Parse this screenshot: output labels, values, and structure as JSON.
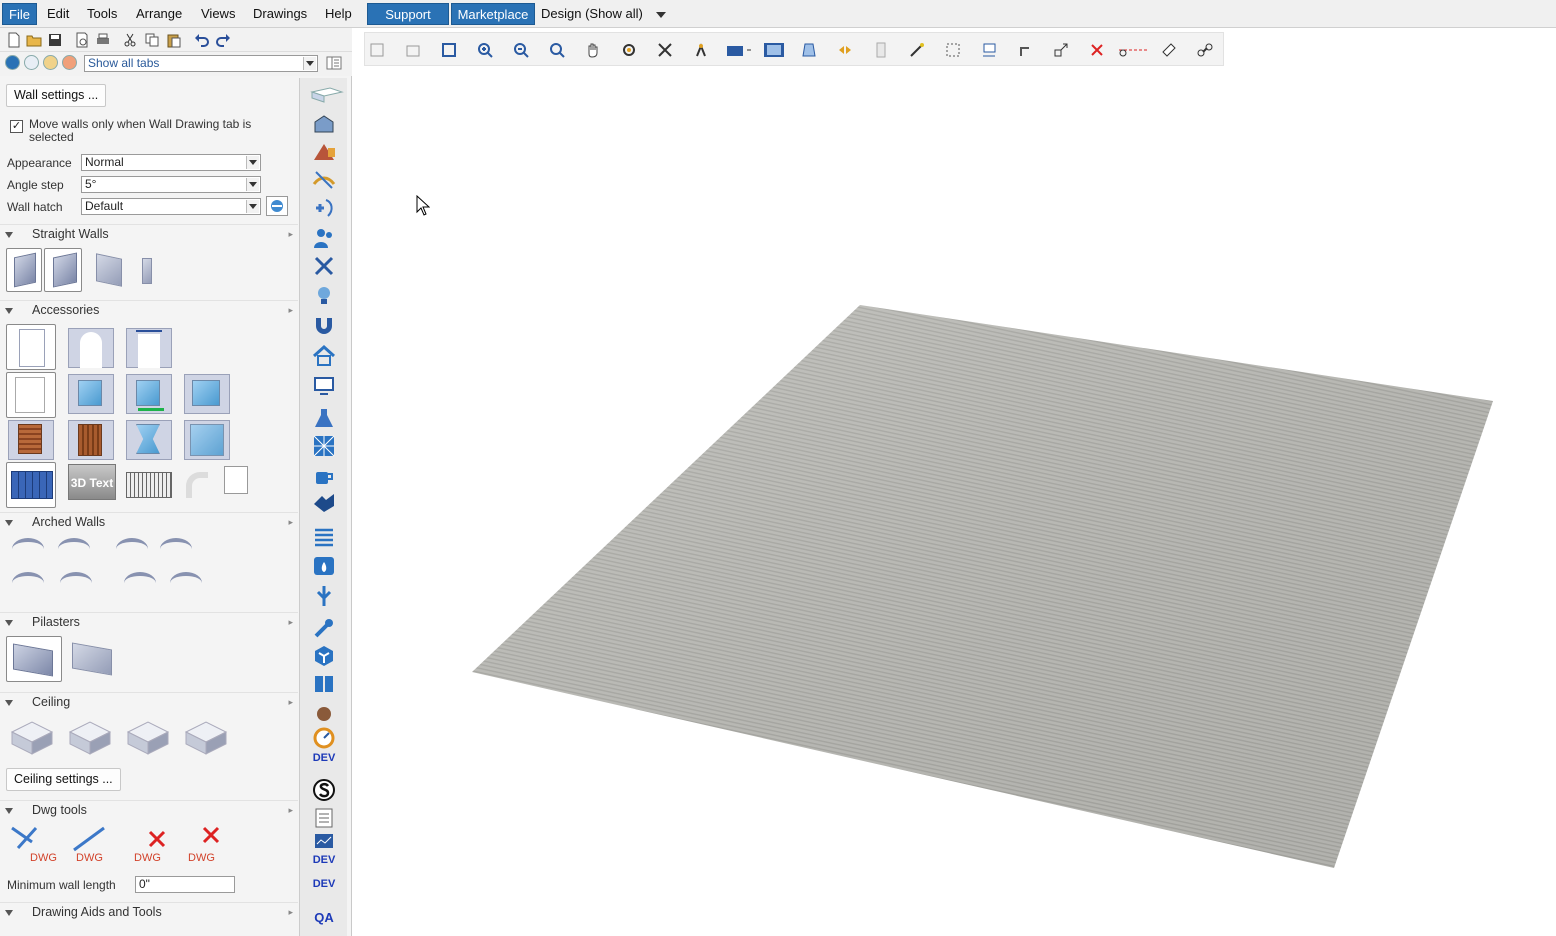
{
  "menubar": {
    "items": [
      "File",
      "Edit",
      "Tools",
      "Arrange",
      "Views",
      "Drawings",
      "Help"
    ],
    "active_item": "File",
    "support_label": "Support",
    "marketplace_label": "Marketplace",
    "design_label": "Design (Show all)"
  },
  "left": {
    "tab_select_value": "Show all tabs",
    "wall_settings_label": "Wall settings ...",
    "move_walls_label": "Move walls only when Wall Drawing tab is selected",
    "move_walls_checked": true,
    "appearance_label": "Appearance",
    "appearance_value": "Normal",
    "angle_step_label": "Angle step",
    "angle_step_value": "5°",
    "wall_hatch_label": "Wall hatch",
    "wall_hatch_value": "Default",
    "sections": {
      "straight_walls": "Straight Walls",
      "accessories": "Accessories",
      "arched_walls": "Arched Walls",
      "pilasters": "Pilasters",
      "ceiling": "Ceiling",
      "dwg_tools": "Dwg tools",
      "drawing_aids": "Drawing Aids and Tools"
    },
    "text_3d_label": "3D Text",
    "dwg_label": "DWG",
    "ceiling_settings_label": "Ceiling settings ...",
    "min_wall_length_label": "Minimum wall length",
    "min_wall_length_value": "0\""
  },
  "vbar": {
    "dev_label": "DEV",
    "qa_label": "QA"
  },
  "colors": {
    "accent": "#2a72b5",
    "floor": "#b9b9b4",
    "panel_bg": "#f4f4f4"
  }
}
